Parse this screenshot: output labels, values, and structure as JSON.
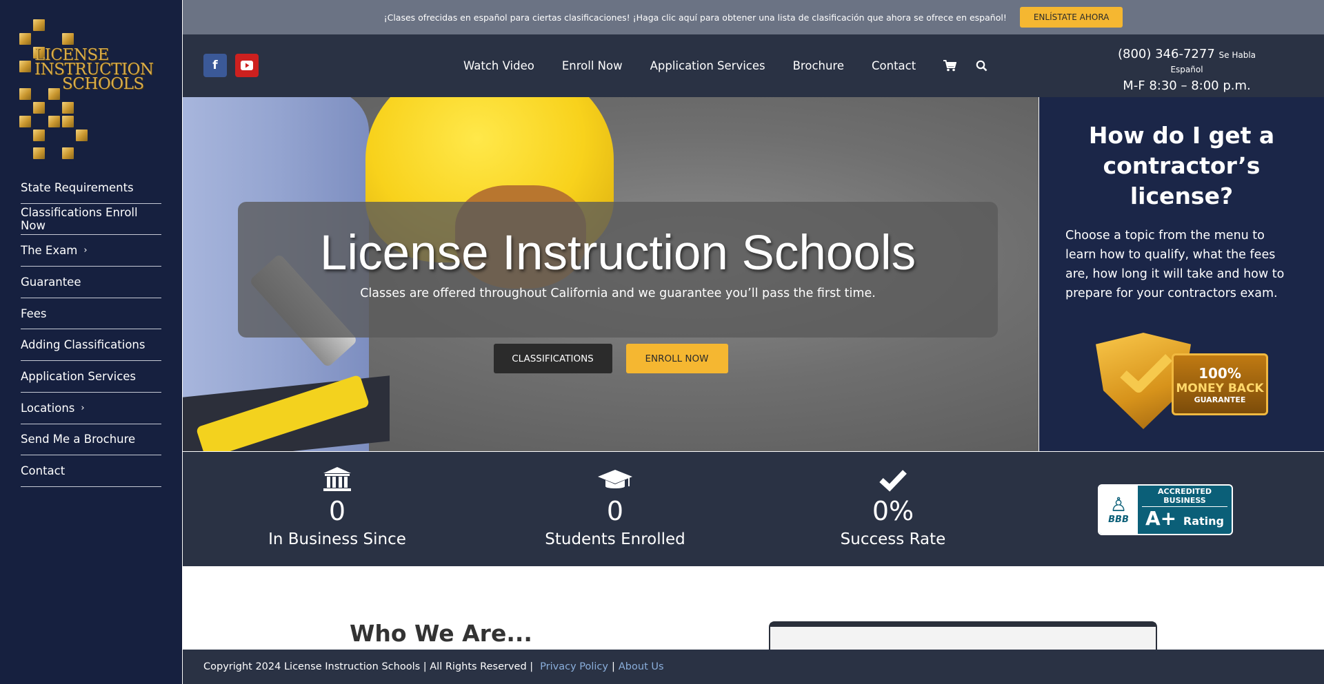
{
  "sidebar": {
    "logo": {
      "line1": "LICENSE",
      "line2": "INSTRUCTION",
      "line3": "SCHOOLS"
    },
    "items": [
      {
        "label": "State Requirements"
      },
      {
        "label": "Classifications Enroll Now"
      },
      {
        "label": "The Exam",
        "chevron": true
      },
      {
        "label": "Guarantee"
      },
      {
        "label": "Fees"
      },
      {
        "label": "Adding Classifications"
      },
      {
        "label": "Application Services"
      },
      {
        "label": "Locations",
        "chevron": true
      },
      {
        "label": "Send Me a Brochure"
      },
      {
        "label": "Contact"
      }
    ]
  },
  "banner": {
    "message": "¡Clases ofrecidas en español para ciertas clasificaciones! ¡Haga clic aquí para obtener una lista de clasificación que ahora se ofrece en español!",
    "button": "ENLÍSTATE AHORA"
  },
  "header": {
    "social": [
      "facebook-icon",
      "youtube-icon"
    ],
    "nav": [
      "Watch Video",
      "Enroll Now",
      "Application Services",
      "Brochure",
      "Contact"
    ],
    "icons": [
      "cart-icon",
      "search-icon"
    ],
    "phone": "(800) 346-7277",
    "phone_note": "Se Habla Español",
    "hours": "M-F 8:30 – 8:00 p.m."
  },
  "hero": {
    "title": "License Instruction Schools",
    "subtitle": "Classes are offered throughout California and we guarantee you’ll pass the first time.",
    "button_classifications": "CLASSIFICATIONS",
    "button_enroll": "ENROLL NOW"
  },
  "panel": {
    "title": "How do I get a contractor’s license?",
    "body": "Choose a topic from the menu to learn how to qualify, what the fees are, how long it will take and how to prepare for your contractors exam.",
    "badge": {
      "line1": "100%",
      "line2": "MONEY BACK",
      "line3": "GUARANTEE"
    }
  },
  "stats": [
    {
      "icon": "bank-icon",
      "value": "0",
      "label": "In Business Since"
    },
    {
      "icon": "graduation-cap-icon",
      "value": "0",
      "label": "Students Enrolled"
    },
    {
      "icon": "check-icon",
      "value": "0%",
      "label": "Success Rate"
    }
  ],
  "bbb": {
    "logo": "BBB",
    "accredited": "ACCREDITED BUSINESS",
    "rating": "A+",
    "rating_word": "Rating"
  },
  "who": {
    "heading": "Who We Are..."
  },
  "footer": {
    "copyright": "Copyright 2024 License Instruction Schools | All Rights Reserved |",
    "privacy": "Privacy Policy",
    "about": "About Us"
  },
  "colors": {
    "accent": "#f5b731",
    "navy": "#16203f",
    "header": "#2a3244",
    "panel": "#1b2648"
  }
}
